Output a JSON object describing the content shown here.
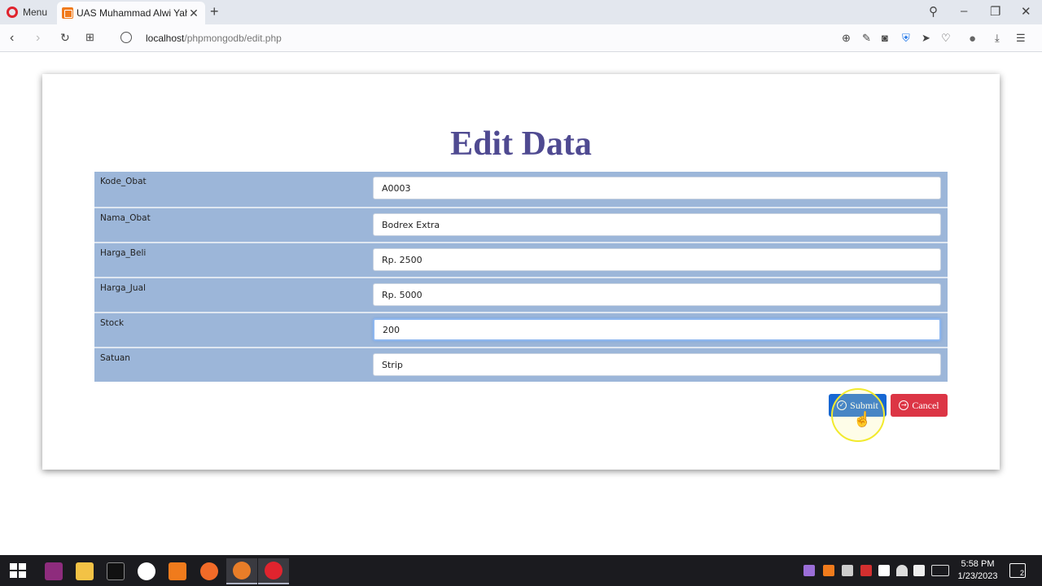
{
  "browser": {
    "menu_label": "Menu",
    "tab_title": "UAS Muhammad Alwi Yahya",
    "url_host": "localhost",
    "url_path": "/phpmongodb/edit.php"
  },
  "page": {
    "title": "Edit Data"
  },
  "form": {
    "rows": [
      {
        "label": "Kode_Obat",
        "value": "A0003"
      },
      {
        "label": "Nama_Obat",
        "value": "Bodrex Extra"
      },
      {
        "label": "Harga_Beli",
        "value": "Rp. 2500"
      },
      {
        "label": "Harga_Jual",
        "value": "Rp. 5000"
      },
      {
        "label": "Stock",
        "value": "200"
      },
      {
        "label": "Satuan",
        "value": "Strip"
      }
    ],
    "submit_label": "Submit",
    "cancel_label": "Cancel"
  },
  "taskbar": {
    "time": "5:58 PM",
    "date": "1/23/2023",
    "notification_count": "2"
  },
  "colors": {
    "title": "#4f4a91",
    "row_bg": "#9cb6d9",
    "submit": "#1767d3",
    "cancel": "#dc3545"
  }
}
